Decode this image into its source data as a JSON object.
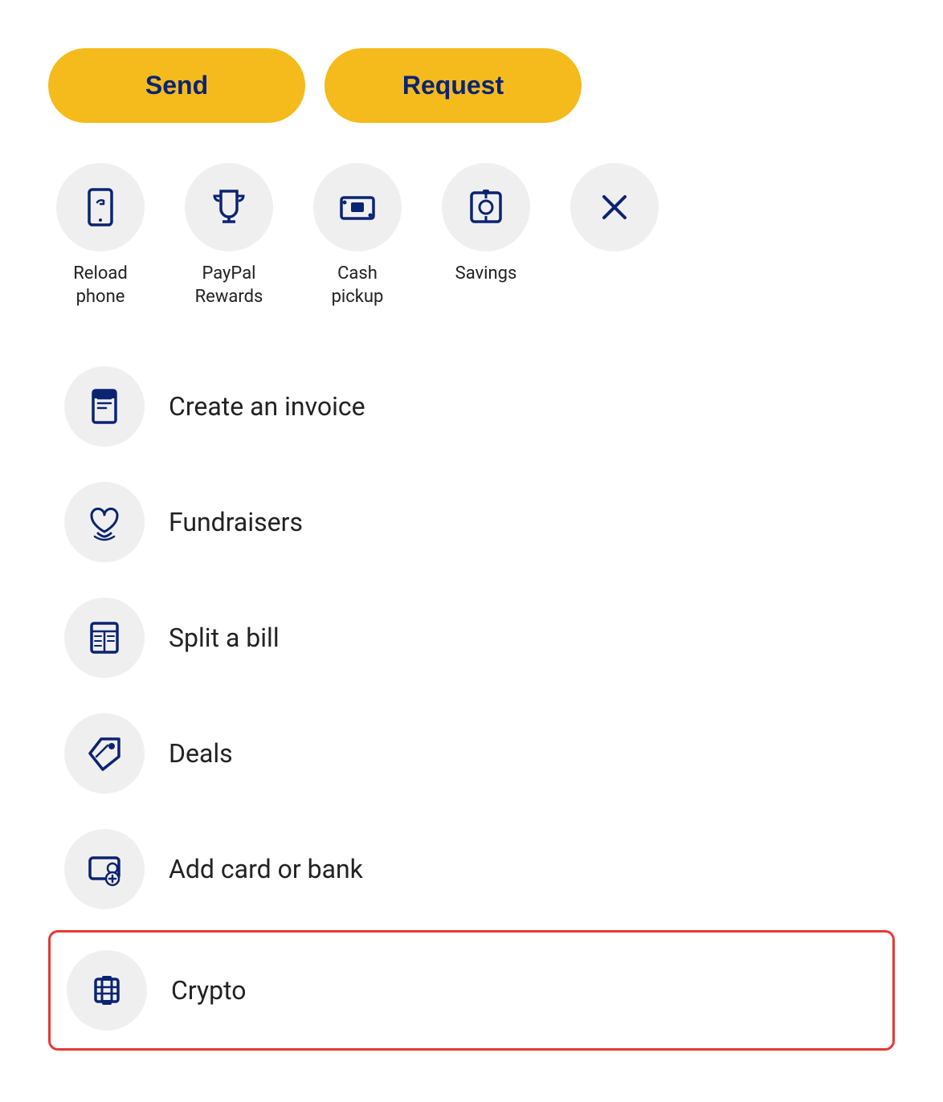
{
  "buttons": {
    "send_label": "Send",
    "request_label": "Request"
  },
  "quick_actions": [
    {
      "id": "reload-phone",
      "label": "Reload\nphone",
      "icon": "reload-phone-icon"
    },
    {
      "id": "paypal-rewards",
      "label": "PayPal\nRewards",
      "icon": "trophy-icon"
    },
    {
      "id": "cash-pickup",
      "label": "Cash\npickup",
      "icon": "cash-pickup-icon"
    },
    {
      "id": "savings",
      "label": "Savings",
      "icon": "savings-icon"
    },
    {
      "id": "close",
      "label": "",
      "icon": "close-icon"
    }
  ],
  "menu_items": [
    {
      "id": "create-invoice",
      "label": "Create an invoice",
      "icon": "invoice-icon",
      "highlighted": false
    },
    {
      "id": "fundraisers",
      "label": "Fundraisers",
      "icon": "fundraisers-icon",
      "highlighted": false
    },
    {
      "id": "split-bill",
      "label": "Split a bill",
      "icon": "split-bill-icon",
      "highlighted": false
    },
    {
      "id": "deals",
      "label": "Deals",
      "icon": "deals-icon",
      "highlighted": false
    },
    {
      "id": "add-card-bank",
      "label": "Add card or bank",
      "icon": "add-card-icon",
      "highlighted": false
    },
    {
      "id": "crypto",
      "label": "Crypto",
      "icon": "crypto-icon",
      "highlighted": true
    }
  ]
}
